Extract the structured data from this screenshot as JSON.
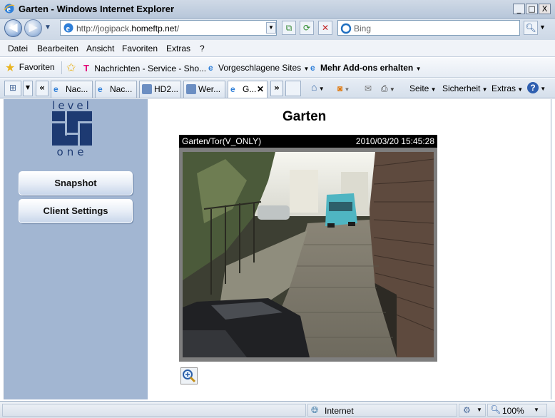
{
  "window": {
    "title": "Garten - Windows Internet Explorer",
    "minimize_glyph": "_",
    "maximize_glyph": "□",
    "close_glyph": "X"
  },
  "address": {
    "url_prefix": "http://jogipack.",
    "url_domain": "homeftp.net",
    "url_suffix": "/",
    "search_placeholder": "Bing"
  },
  "menu": {
    "items": [
      "Datei",
      "Bearbeiten",
      "Ansicht",
      "Favoriten",
      "Extras",
      "?"
    ]
  },
  "favorites": {
    "favorites_label": "Favoriten",
    "items": [
      "Nachrichten - Service - Sho...",
      "Vorgeschlagene Sites",
      "Mehr Add-ons erhalten"
    ]
  },
  "tabs": {
    "items": [
      "Nac...",
      "Nac...",
      "HD2...",
      "Wer...",
      "G..."
    ],
    "active_index": 4,
    "close_glyph": "✕",
    "more_glyph": "»",
    "back_glyph": "«"
  },
  "commandbar": {
    "page_label": "Seite",
    "safety_label": "Sicherheit",
    "tools_label": "Extras"
  },
  "page": {
    "logo_top": "level",
    "logo_bottom": "one",
    "title": "Garten",
    "snapshot_label": "Snapshot",
    "client_settings_label": "Client Settings",
    "camera_name": "Garten/Tor(V_ONLY)",
    "camera_timestamp": "2010/03/20 15:45:28"
  },
  "status": {
    "zone": "Internet",
    "zoom": "100%"
  },
  "colors": {
    "sidebar": "#a2b6d2",
    "camera_header": "#000000"
  }
}
